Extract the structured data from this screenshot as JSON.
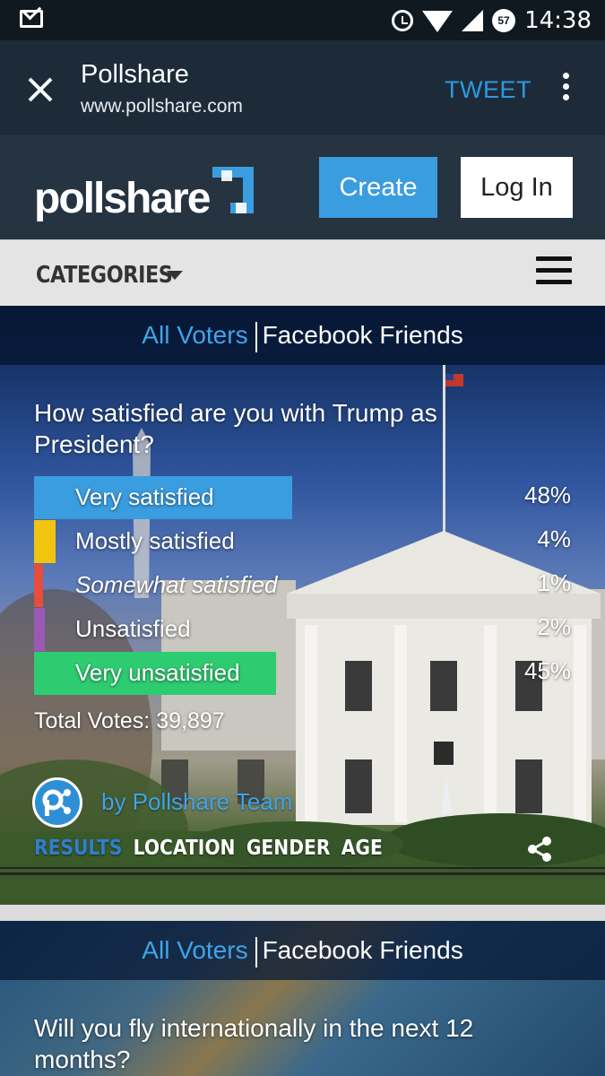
{
  "status_bar": {
    "time": "14:38",
    "battery": "57"
  },
  "app_bar": {
    "title": "Pollshare",
    "url": "www.pollshare.com",
    "tweet_label": "TWEET"
  },
  "site_header": {
    "logo_text": "pollshare",
    "create_label": "Create",
    "login_label": "Log In"
  },
  "categories_bar": {
    "label": "CATEGORIES"
  },
  "polls": [
    {
      "tabs": {
        "all_voters": "All Voters",
        "facebook_friends": "Facebook Friends"
      },
      "question": "How satisfied are you with Trump as President?",
      "options": [
        {
          "label": "Very satisfied",
          "percent": "48%",
          "value": 48,
          "color": "#3a9de0"
        },
        {
          "label": "Mostly satisfied",
          "percent": "4%",
          "value": 4,
          "color": "#f1c40f"
        },
        {
          "label": "Somewhat satisfied",
          "percent": "1%",
          "value": 1,
          "color": "#e74c3c"
        },
        {
          "label": "Unsatisfied",
          "percent": "2%",
          "value": 2,
          "color": "#9b59b6"
        },
        {
          "label": "Very unsatisfied",
          "percent": "45%",
          "value": 45,
          "color": "#2ecc71"
        }
      ],
      "total_votes": "Total Votes: 39,897",
      "author": "by Pollshare Team",
      "result_tabs": [
        "RESULTS",
        "LOCATION",
        "GENDER",
        "AGE"
      ]
    },
    {
      "tabs": {
        "all_voters": "All Voters",
        "facebook_friends": "Facebook Friends"
      },
      "question": "Will you fly internationally in the next 12 months?"
    }
  ],
  "colors": {
    "accent": "#3a9de0",
    "header_bg": "#263341",
    "app_bar_bg": "#1d2b38"
  },
  "icons": [
    "mail-icon",
    "alarm-icon",
    "wifi-icon",
    "signal-icon",
    "close-icon",
    "more-vert-icon",
    "caret-down-icon",
    "hamburger-menu-icon",
    "share-icon"
  ]
}
